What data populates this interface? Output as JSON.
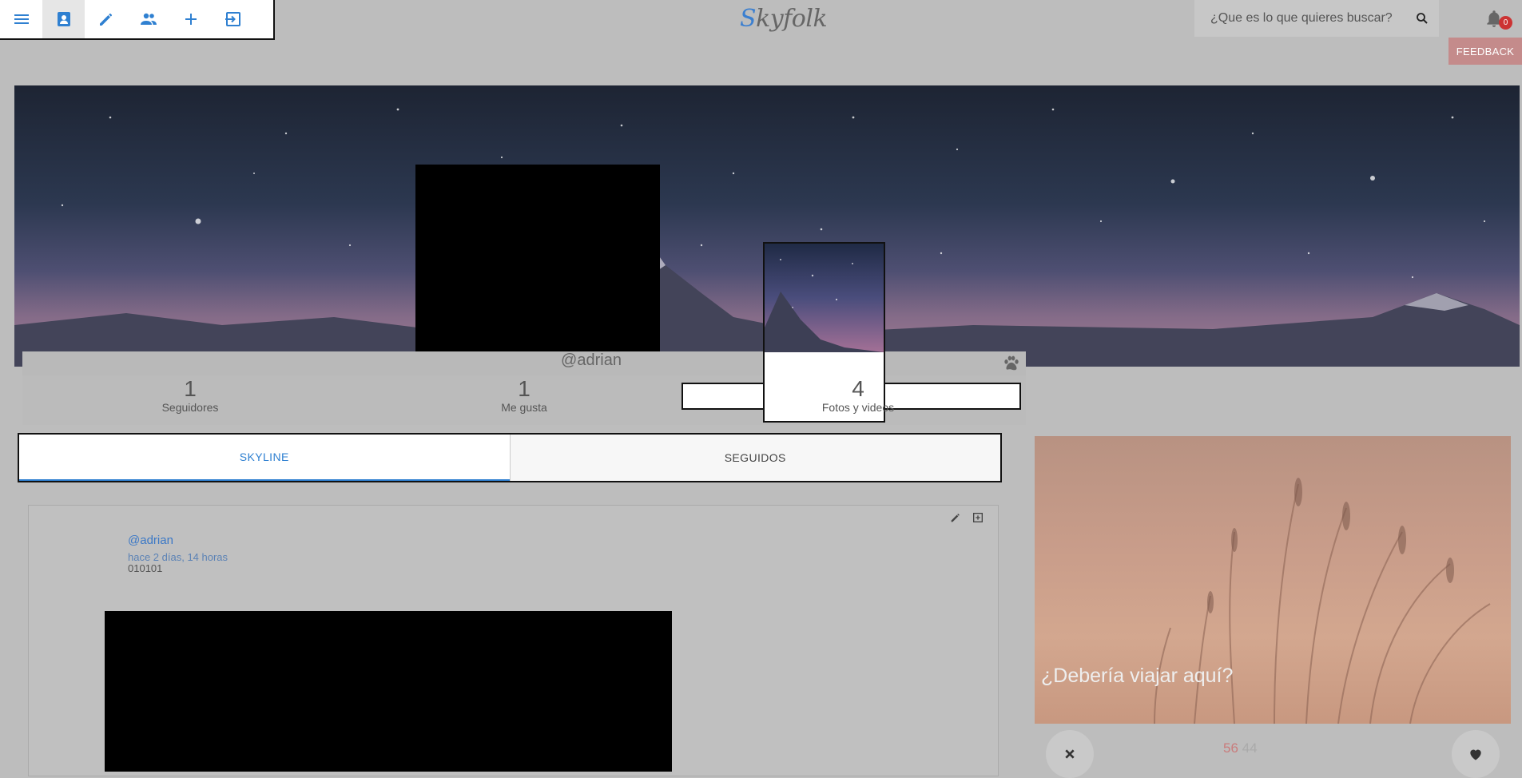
{
  "app": {
    "logo_first": "S",
    "logo_rest": "kyfolk"
  },
  "toolbar": {
    "items": [
      {
        "icon": "menu-icon"
      },
      {
        "icon": "profile-icon",
        "active": true
      },
      {
        "icon": "edit-icon"
      },
      {
        "icon": "people-icon"
      },
      {
        "icon": "plus-icon"
      },
      {
        "icon": "logout-icon"
      }
    ]
  },
  "search": {
    "placeholder": "¿Que es lo que quieres buscar?"
  },
  "notifications": {
    "count": "0"
  },
  "feedback": {
    "label": "FEEDBACK"
  },
  "profile": {
    "username": "@adrian",
    "stats": [
      {
        "value": "1",
        "label": "Seguidores"
      },
      {
        "value": "1",
        "label": "Me gusta"
      },
      {
        "value": "4",
        "label": "Fotos y videos"
      }
    ]
  },
  "tabs": [
    {
      "label": "SKYLINE",
      "active": true
    },
    {
      "label": "SEGUIDOS",
      "active": false
    }
  ],
  "post": {
    "user": "@adrian",
    "time": "hace 2 días, 14 horas",
    "text": "010101"
  },
  "suggestion": {
    "caption": "¿Debería viajar aquí?",
    "count_a": "56",
    "count_b": "44"
  },
  "colors": {
    "accent": "#2f80d1",
    "feedback": "#c48b8b",
    "badge": "#cc3333"
  }
}
